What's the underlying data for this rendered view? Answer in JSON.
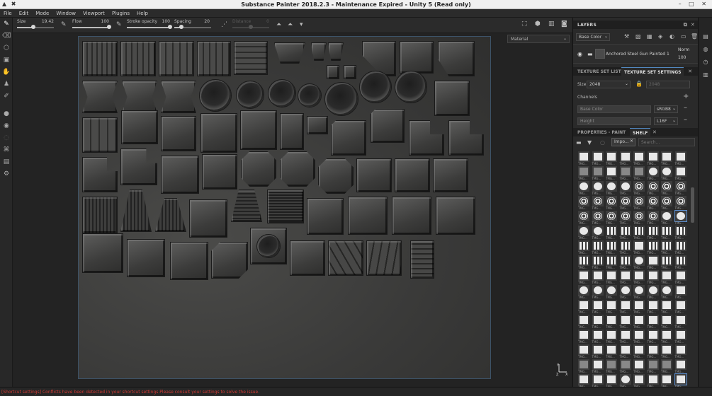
{
  "window": {
    "title": "Substance Painter 2018.2.3 - Maintenance Expired - Unity 5 (Read only)",
    "left_controls": "▲ ✖",
    "right_controls": "– □ ✕"
  },
  "menu": [
    "File",
    "Edit",
    "Mode",
    "Window",
    "Viewport",
    "Plugins",
    "Help"
  ],
  "toolbar": {
    "size_label": "Size",
    "size_value": "19.42",
    "size_level": 0.45,
    "flow_label": "Flow",
    "flow_value": "100",
    "flow_level": 1.0,
    "stroke_opacity_label": "Stroke opacity",
    "stroke_opacity_value": "100",
    "stroke_opacity_level": 1.0,
    "spacing_label": "Spacing",
    "spacing_value": "20",
    "spacing_level": 0.2,
    "distance_label": "Distance",
    "distance_value": "0"
  },
  "viewport": {
    "mode": "Material"
  },
  "layers": {
    "title": "LAYERS",
    "channel_select": "Base Color",
    "layer_name": "Anchored Steel Gun Painted 1",
    "blend_mode": "Norm",
    "opacity": "100"
  },
  "texture_set": {
    "tab_list": "TEXTURE SET LIST",
    "tab_settings": "TEXTURE SET SETTINGS",
    "size_label": "Size",
    "size_value": "2048",
    "size_value_disabled": "2048",
    "channels_label": "Channels",
    "channels": [
      {
        "name": "Base Color",
        "format": "sRGB8"
      },
      {
        "name": "Height",
        "format": "L16F"
      }
    ]
  },
  "shelf": {
    "tab_properties": "PROPERTIES - PAINT",
    "tab_shelf": "SHELF",
    "filter_tag": "Impo...",
    "search_placeholder": "Search...",
    "item_caption": "TMG..."
  },
  "status": {
    "message": "[Shortcut settings] Conflicts have been detected in your shortcut settings.Please consult your settings to solve the issue."
  }
}
